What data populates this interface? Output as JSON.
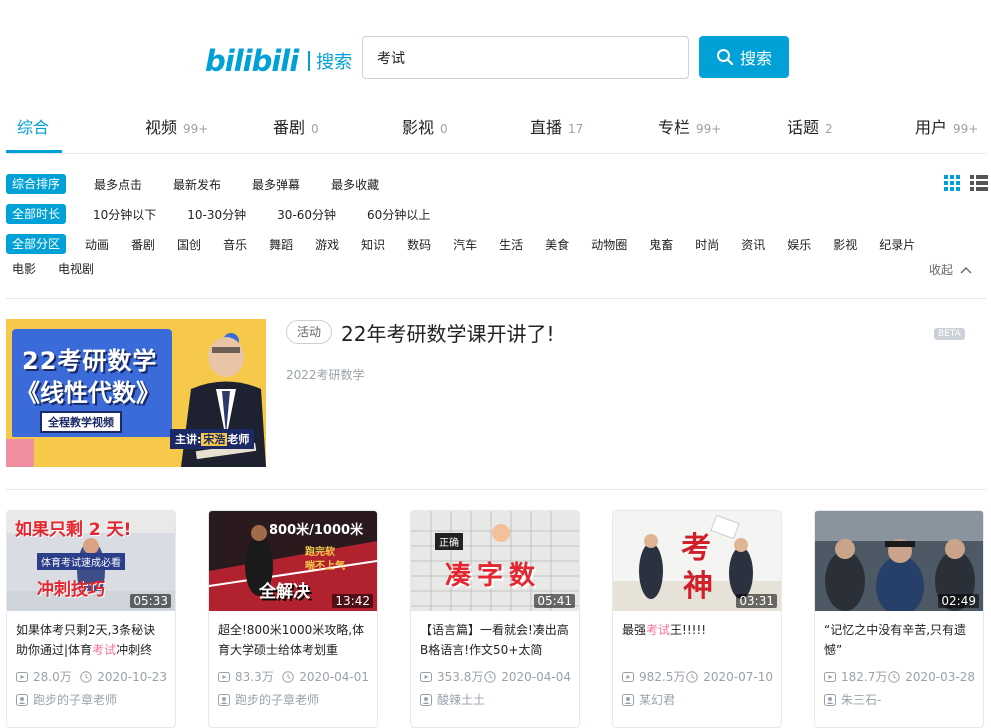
{
  "header": {
    "logo": "bilibili",
    "logo_text": "搜索",
    "query": "考试",
    "search_label": "搜索"
  },
  "tabs": [
    {
      "label": "综合",
      "count": ""
    },
    {
      "label": "视频",
      "count": "99+"
    },
    {
      "label": "番剧",
      "count": "0"
    },
    {
      "label": "影视",
      "count": "0"
    },
    {
      "label": "直播",
      "count": "17"
    },
    {
      "label": "专栏",
      "count": "99+"
    },
    {
      "label": "话题",
      "count": "2"
    },
    {
      "label": "用户",
      "count": "99+"
    }
  ],
  "filters": {
    "order": {
      "active": "综合排序",
      "items": [
        "最多点击",
        "最新发布",
        "最多弹幕",
        "最多收藏"
      ]
    },
    "duration": {
      "active": "全部时长",
      "items": [
        "10分钟以下",
        "10-30分钟",
        "30-60分钟",
        "60分钟以上"
      ]
    },
    "zone": {
      "active": "全部分区",
      "items": [
        "动画",
        "番剧",
        "国创",
        "音乐",
        "舞蹈",
        "游戏",
        "知识",
        "数码",
        "汽车",
        "生活",
        "美食",
        "动物圈",
        "鬼畜",
        "时尚",
        "资讯",
        "娱乐",
        "影视",
        "纪录片"
      ],
      "items2": [
        "电影",
        "电视剧"
      ]
    },
    "collapse": "收起"
  },
  "activity": {
    "tag": "活动",
    "title": "22年考研数学课开讲了!",
    "badge": "BETA",
    "subtitle": "2022考研数学",
    "banner": {
      "l1": "22考研数学",
      "l2": "《线性代数》",
      "l3": "全程教学视频",
      "teacher_prefix": "主讲:",
      "teacher": "宋浩",
      "teacher_suffix": "老师"
    }
  },
  "videos": [
    {
      "thumb": {
        "l1": "如果只剩 2 天!",
        "l2": "体育考试速成必看",
        "l3": "冲刺技巧"
      },
      "duration": "05:33",
      "title_pre": "如果体考只剩2天,3条秘诀助你通过|体育",
      "title_hl": "考试",
      "title_post": "冲刺终",
      "views": "28.0万",
      "date": "2020-10-23",
      "author": "跑步的子章老师"
    },
    {
      "thumb": {
        "l1": "800米/1000米",
        "l2": "跑完软",
        "l3": "喘不上气",
        "l4": "全解决"
      },
      "duration": "13:42",
      "title_pre": "超全!800米1000米攻略,体育大学硕士给体考划重",
      "title_hl": "",
      "title_post": "",
      "views": "83.3万",
      "date": "2020-04-01",
      "author": "跑步的子章老师"
    },
    {
      "thumb": {
        "l1": "正确",
        "l2": "凑字数"
      },
      "duration": "05:41",
      "title_pre": "【语言篇】一看就会!凑出高B格语言!作文50+太简",
      "title_hl": "",
      "title_post": "",
      "views": "353.8万",
      "date": "2020-04-04",
      "author": "酸辣土土"
    },
    {
      "thumb": {
        "l1": "考",
        "l2": "神"
      },
      "duration": "03:31",
      "title_pre": "最强",
      "title_hl": "考试",
      "title_post": "王!!!!!",
      "views": "982.5万",
      "date": "2020-07-10",
      "author": "某幻君"
    },
    {
      "thumb": {},
      "duration": "02:49",
      "title_pre": "“记忆之中没有辛苦,只有遗憾”",
      "title_hl": "",
      "title_post": "",
      "views": "182.7万",
      "date": "2020-03-28",
      "author": "朱三石-"
    }
  ],
  "colors": {
    "accent": "#00a1d6",
    "highlight": "#fb7299",
    "muted": "#99a2aa"
  }
}
